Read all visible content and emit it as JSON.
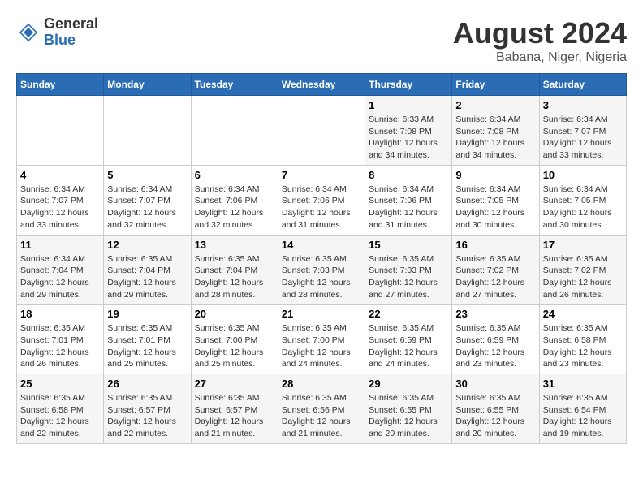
{
  "header": {
    "logo_general": "General",
    "logo_blue": "Blue",
    "month_year": "August 2024",
    "location": "Babana, Niger, Nigeria"
  },
  "calendar": {
    "weekdays": [
      "Sunday",
      "Monday",
      "Tuesday",
      "Wednesday",
      "Thursday",
      "Friday",
      "Saturday"
    ],
    "weeks": [
      [
        {
          "day": "",
          "info": ""
        },
        {
          "day": "",
          "info": ""
        },
        {
          "day": "",
          "info": ""
        },
        {
          "day": "",
          "info": ""
        },
        {
          "day": "1",
          "info": "Sunrise: 6:33 AM\nSunset: 7:08 PM\nDaylight: 12 hours\nand 34 minutes."
        },
        {
          "day": "2",
          "info": "Sunrise: 6:34 AM\nSunset: 7:08 PM\nDaylight: 12 hours\nand 34 minutes."
        },
        {
          "day": "3",
          "info": "Sunrise: 6:34 AM\nSunset: 7:07 PM\nDaylight: 12 hours\nand 33 minutes."
        }
      ],
      [
        {
          "day": "4",
          "info": "Sunrise: 6:34 AM\nSunset: 7:07 PM\nDaylight: 12 hours\nand 33 minutes."
        },
        {
          "day": "5",
          "info": "Sunrise: 6:34 AM\nSunset: 7:07 PM\nDaylight: 12 hours\nand 32 minutes."
        },
        {
          "day": "6",
          "info": "Sunrise: 6:34 AM\nSunset: 7:06 PM\nDaylight: 12 hours\nand 32 minutes."
        },
        {
          "day": "7",
          "info": "Sunrise: 6:34 AM\nSunset: 7:06 PM\nDaylight: 12 hours\nand 31 minutes."
        },
        {
          "day": "8",
          "info": "Sunrise: 6:34 AM\nSunset: 7:06 PM\nDaylight: 12 hours\nand 31 minutes."
        },
        {
          "day": "9",
          "info": "Sunrise: 6:34 AM\nSunset: 7:05 PM\nDaylight: 12 hours\nand 30 minutes."
        },
        {
          "day": "10",
          "info": "Sunrise: 6:34 AM\nSunset: 7:05 PM\nDaylight: 12 hours\nand 30 minutes."
        }
      ],
      [
        {
          "day": "11",
          "info": "Sunrise: 6:34 AM\nSunset: 7:04 PM\nDaylight: 12 hours\nand 29 minutes."
        },
        {
          "day": "12",
          "info": "Sunrise: 6:35 AM\nSunset: 7:04 PM\nDaylight: 12 hours\nand 29 minutes."
        },
        {
          "day": "13",
          "info": "Sunrise: 6:35 AM\nSunset: 7:04 PM\nDaylight: 12 hours\nand 28 minutes."
        },
        {
          "day": "14",
          "info": "Sunrise: 6:35 AM\nSunset: 7:03 PM\nDaylight: 12 hours\nand 28 minutes."
        },
        {
          "day": "15",
          "info": "Sunrise: 6:35 AM\nSunset: 7:03 PM\nDaylight: 12 hours\nand 27 minutes."
        },
        {
          "day": "16",
          "info": "Sunrise: 6:35 AM\nSunset: 7:02 PM\nDaylight: 12 hours\nand 27 minutes."
        },
        {
          "day": "17",
          "info": "Sunrise: 6:35 AM\nSunset: 7:02 PM\nDaylight: 12 hours\nand 26 minutes."
        }
      ],
      [
        {
          "day": "18",
          "info": "Sunrise: 6:35 AM\nSunset: 7:01 PM\nDaylight: 12 hours\nand 26 minutes."
        },
        {
          "day": "19",
          "info": "Sunrise: 6:35 AM\nSunset: 7:01 PM\nDaylight: 12 hours\nand 25 minutes."
        },
        {
          "day": "20",
          "info": "Sunrise: 6:35 AM\nSunset: 7:00 PM\nDaylight: 12 hours\nand 25 minutes."
        },
        {
          "day": "21",
          "info": "Sunrise: 6:35 AM\nSunset: 7:00 PM\nDaylight: 12 hours\nand 24 minutes."
        },
        {
          "day": "22",
          "info": "Sunrise: 6:35 AM\nSunset: 6:59 PM\nDaylight: 12 hours\nand 24 minutes."
        },
        {
          "day": "23",
          "info": "Sunrise: 6:35 AM\nSunset: 6:59 PM\nDaylight: 12 hours\nand 23 minutes."
        },
        {
          "day": "24",
          "info": "Sunrise: 6:35 AM\nSunset: 6:58 PM\nDaylight: 12 hours\nand 23 minutes."
        }
      ],
      [
        {
          "day": "25",
          "info": "Sunrise: 6:35 AM\nSunset: 6:58 PM\nDaylight: 12 hours\nand 22 minutes."
        },
        {
          "day": "26",
          "info": "Sunrise: 6:35 AM\nSunset: 6:57 PM\nDaylight: 12 hours\nand 22 minutes."
        },
        {
          "day": "27",
          "info": "Sunrise: 6:35 AM\nSunset: 6:57 PM\nDaylight: 12 hours\nand 21 minutes."
        },
        {
          "day": "28",
          "info": "Sunrise: 6:35 AM\nSunset: 6:56 PM\nDaylight: 12 hours\nand 21 minutes."
        },
        {
          "day": "29",
          "info": "Sunrise: 6:35 AM\nSunset: 6:55 PM\nDaylight: 12 hours\nand 20 minutes."
        },
        {
          "day": "30",
          "info": "Sunrise: 6:35 AM\nSunset: 6:55 PM\nDaylight: 12 hours\nand 20 minutes."
        },
        {
          "day": "31",
          "info": "Sunrise: 6:35 AM\nSunset: 6:54 PM\nDaylight: 12 hours\nand 19 minutes."
        }
      ]
    ]
  }
}
